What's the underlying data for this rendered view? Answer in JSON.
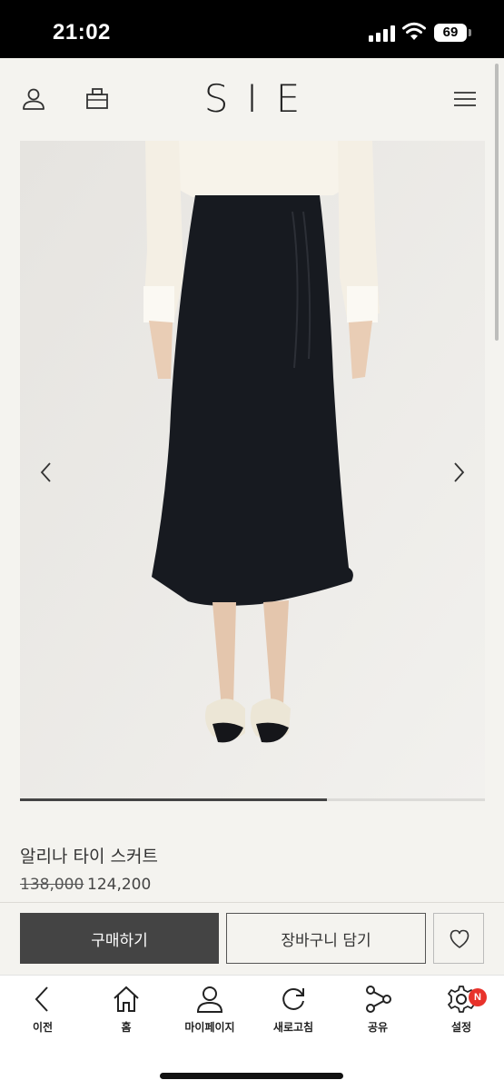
{
  "status_bar": {
    "time": "21:02",
    "battery": "69"
  },
  "header": {
    "logo": "SIE",
    "icons": [
      "user-icon",
      "shopping-bag-icon",
      "hamburger-menu-icon"
    ]
  },
  "gallery": {
    "progress": 0.66,
    "icons": [
      "chevron-left-icon",
      "chevron-right-icon"
    ]
  },
  "product": {
    "name": "알리나 타이 스커트",
    "price_original": "138,000",
    "price_sale": "124,200"
  },
  "actions": {
    "buy_label": "구매하기",
    "cart_label": "장바구니 담기",
    "wish_icon": "heart-icon"
  },
  "bottom_nav": {
    "items": [
      {
        "label": "이전",
        "icon": "back-arrow-icon"
      },
      {
        "label": "홈",
        "icon": "home-icon"
      },
      {
        "label": "마이페이지",
        "icon": "person-icon"
      },
      {
        "label": "새로고침",
        "icon": "refresh-icon"
      },
      {
        "label": "공유",
        "icon": "share-icon"
      },
      {
        "label": "설정",
        "icon": "settings-icon"
      }
    ],
    "settings_badge": "N"
  },
  "colors": {
    "background": "#f4f3ef",
    "buy_button": "#444444",
    "badge": "#e8322b"
  }
}
